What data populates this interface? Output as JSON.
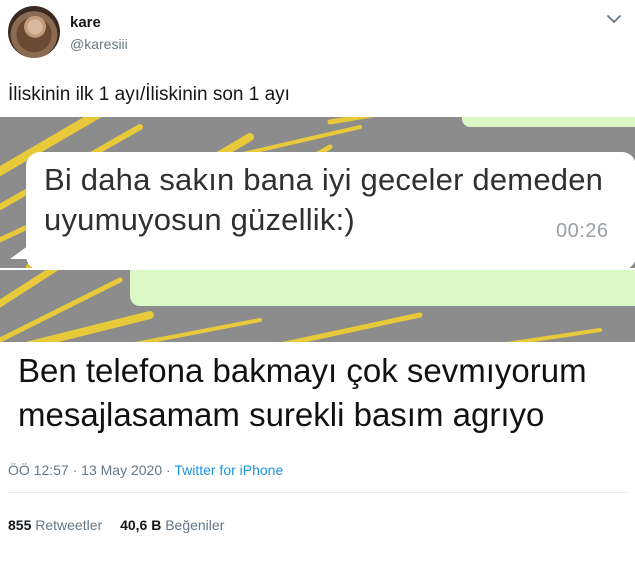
{
  "author": {
    "name": "kare",
    "handle": "@karesiii"
  },
  "tweet": {
    "text": "İliskinin ilk 1 ayı/İliskinin son 1 ayı",
    "time": "ÖÖ 12:57",
    "separator": "·",
    "date": "13 May 2020",
    "source": "Twitter for iPhone"
  },
  "screenshot_top": {
    "message_line1": "Bi daha sakın bana iyi geceler demeden",
    "message_line2": "uyumuyosun güzellik:)",
    "time": "00:26"
  },
  "screenshot_bottom": {
    "message_line1": "Ben telefona bakmayı çok sevmıyorum",
    "message_line2": "mesajlasamam surekli basım agrıyo"
  },
  "stats": {
    "retweets_count": "855",
    "retweets_label": "Retweetler",
    "likes_count": "40,6 B",
    "likes_label": "Beğeniler"
  },
  "colors": {
    "chat_background": "#8c8c8c",
    "streak_yellow": "#e8c93a",
    "outgoing_bubble": "#dcf8c6",
    "link_blue": "#1b95e0",
    "muted_text": "#657786"
  },
  "icons": {
    "menu": "chevron-down-icon"
  }
}
